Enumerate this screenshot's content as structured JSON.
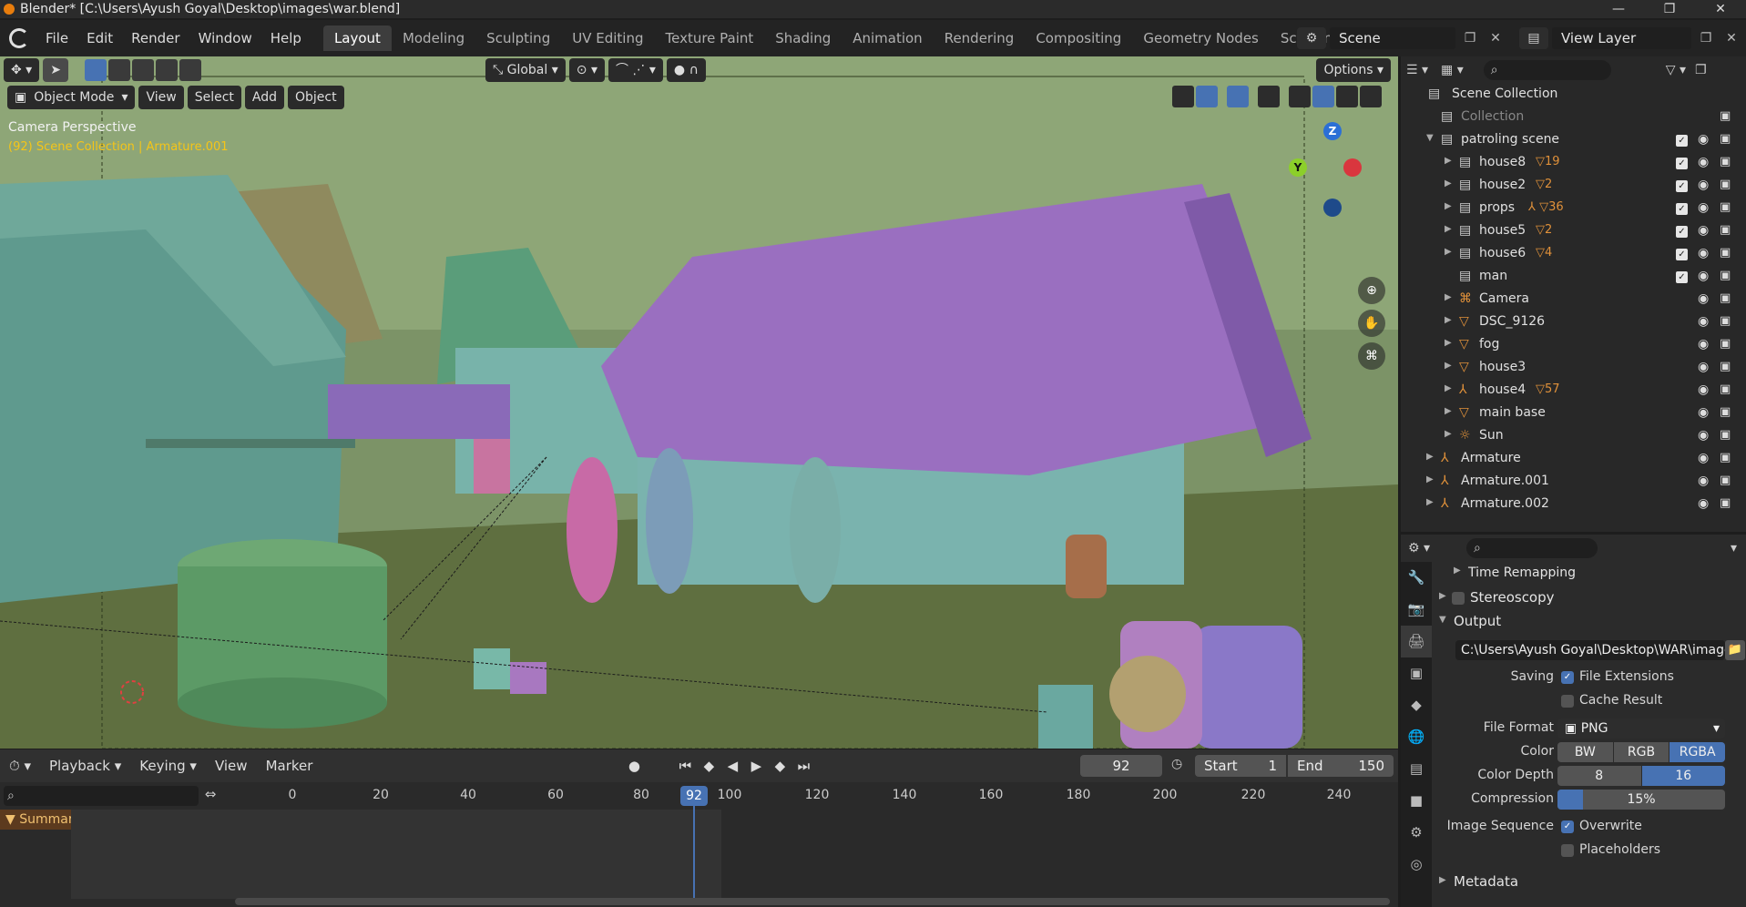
{
  "window": {
    "title": "Blender* [C:\\Users\\Ayush Goyal\\Desktop\\images\\war.blend]",
    "minimize": "—",
    "maximize": "❐",
    "close": "✕"
  },
  "menu": {
    "file": "File",
    "edit": "Edit",
    "render": "Render",
    "window": "Window",
    "help": "Help"
  },
  "workspaces": [
    "Layout",
    "Modeling",
    "Sculpting",
    "UV Editing",
    "Texture Paint",
    "Shading",
    "Animation",
    "Rendering",
    "Compositing",
    "Geometry Nodes",
    "Scripting"
  ],
  "scene": {
    "name": "Scene"
  },
  "view_layer": {
    "name": "View Layer"
  },
  "viewport": {
    "transform_orientation": "Global",
    "options": "Options",
    "mode": "Object Mode",
    "view": "View",
    "select": "Select",
    "add": "Add",
    "object": "Object",
    "info_perspective": "Camera Perspective",
    "info_collection": "(92) Scene Collection | Armature.001",
    "gizmo": {
      "z": "Z",
      "y": "Y"
    }
  },
  "timeline": {
    "playback": "Playback",
    "keying": "Keying",
    "view": "View",
    "marker": "Marker",
    "current_frame": "92",
    "start_label": "Start",
    "start_value": "1",
    "end_label": "End",
    "end_value": "150",
    "summary": "Summary",
    "ticks": [
      "0",
      "20",
      "40",
      "60",
      "80",
      "100",
      "120",
      "140",
      "160",
      "180",
      "200",
      "220",
      "240"
    ],
    "cursor_frame": "92"
  },
  "outliner": {
    "scene_collection": "Scene Collection",
    "rows": [
      {
        "name": "Collection",
        "level": 1,
        "expander": "",
        "icon": "collection-icon",
        "extra": "",
        "checkbox": false,
        "eye": false,
        "dim": true
      },
      {
        "name": "patroling scene",
        "level": 1,
        "expander": "▼",
        "icon": "collection-icon",
        "extra": "",
        "checkbox": true,
        "eye": true,
        "dim": false
      },
      {
        "name": "house8",
        "level": 2,
        "expander": "▶",
        "icon": "collection-icon",
        "extra": "▽19",
        "checkbox": true,
        "eye": true,
        "dim": false
      },
      {
        "name": "house2",
        "level": 2,
        "expander": "▶",
        "icon": "collection-icon",
        "extra": "▽2",
        "checkbox": true,
        "eye": true,
        "dim": false
      },
      {
        "name": "props",
        "level": 2,
        "expander": "▶",
        "icon": "collection-icon",
        "extra": "⅄ ▽36",
        "checkbox": true,
        "eye": true,
        "dim": false
      },
      {
        "name": "house5",
        "level": 2,
        "expander": "▶",
        "icon": "collection-icon",
        "extra": "▽2",
        "checkbox": true,
        "eye": true,
        "dim": false
      },
      {
        "name": "house6",
        "level": 2,
        "expander": "▶",
        "icon": "collection-icon",
        "extra": "▽4",
        "checkbox": true,
        "eye": true,
        "dim": false
      },
      {
        "name": "man",
        "level": 2,
        "expander": "",
        "icon": "collection-icon",
        "extra": "",
        "checkbox": true,
        "eye": true,
        "dim": false
      },
      {
        "name": "Camera",
        "level": 2,
        "expander": "▶",
        "icon": "camera-icon",
        "extra": "",
        "checkbox": false,
        "eye": true,
        "dim": false
      },
      {
        "name": "DSC_9126",
        "level": 2,
        "expander": "▶",
        "icon": "mesh-icon",
        "extra": "",
        "checkbox": false,
        "eye": true,
        "dim": false
      },
      {
        "name": "fog",
        "level": 2,
        "expander": "▶",
        "icon": "mesh-icon",
        "extra": "",
        "checkbox": false,
        "eye": true,
        "dim": false
      },
      {
        "name": "house3",
        "level": 2,
        "expander": "▶",
        "icon": "mesh-icon",
        "extra": "",
        "checkbox": false,
        "eye": true,
        "dim": false
      },
      {
        "name": "house4",
        "level": 2,
        "expander": "▶",
        "icon": "armature-icon",
        "extra": "▽57",
        "checkbox": false,
        "eye": true,
        "dim": false
      },
      {
        "name": "main base",
        "level": 2,
        "expander": "▶",
        "icon": "mesh-icon",
        "extra": "",
        "checkbox": false,
        "eye": true,
        "dim": false
      },
      {
        "name": "Sun",
        "level": 2,
        "expander": "▶",
        "icon": "light-icon",
        "extra": "",
        "checkbox": false,
        "eye": true,
        "dim": false
      },
      {
        "name": "Armature",
        "level": 1,
        "expander": "▶",
        "icon": "armature-icon",
        "extra": "",
        "checkbox": false,
        "eye": true,
        "dim": false
      },
      {
        "name": "Armature.001",
        "level": 1,
        "expander": "▶",
        "icon": "armature-icon",
        "extra": "",
        "checkbox": false,
        "eye": true,
        "dim": false
      },
      {
        "name": "Armature.002",
        "level": 1,
        "expander": "▶",
        "icon": "armature-icon",
        "extra": "",
        "checkbox": false,
        "eye": true,
        "dim": false
      }
    ]
  },
  "properties": {
    "time_remapping": "Time Remapping",
    "stereoscopy": "Stereoscopy",
    "output": "Output",
    "output_path": "C:\\Users\\Ayush Goyal\\Desktop\\WAR\\image...",
    "saving_label": "Saving",
    "file_extensions": "File Extensions",
    "cache_result": "Cache Result",
    "file_format_label": "File Format",
    "file_format": "PNG",
    "color_label": "Color",
    "color_options": [
      "BW",
      "RGB",
      "RGBA"
    ],
    "color_selected": "RGBA",
    "color_depth_label": "Color Depth",
    "color_depth_options": [
      "8",
      "16"
    ],
    "color_depth_selected": "16",
    "compression_label": "Compression",
    "compression": "15%",
    "compression_fraction": 0.15,
    "image_sequence_label": "Image Sequence",
    "overwrite": "Overwrite",
    "placeholders": "Placeholders",
    "metadata": "Metadata"
  },
  "colors": {
    "accent": "#4772b3",
    "viewport_ground": "#5c6e43",
    "roof_purple": "#9a6fc0",
    "house_teal": "#6fa89a",
    "selection_yellow": "#f5c518"
  }
}
